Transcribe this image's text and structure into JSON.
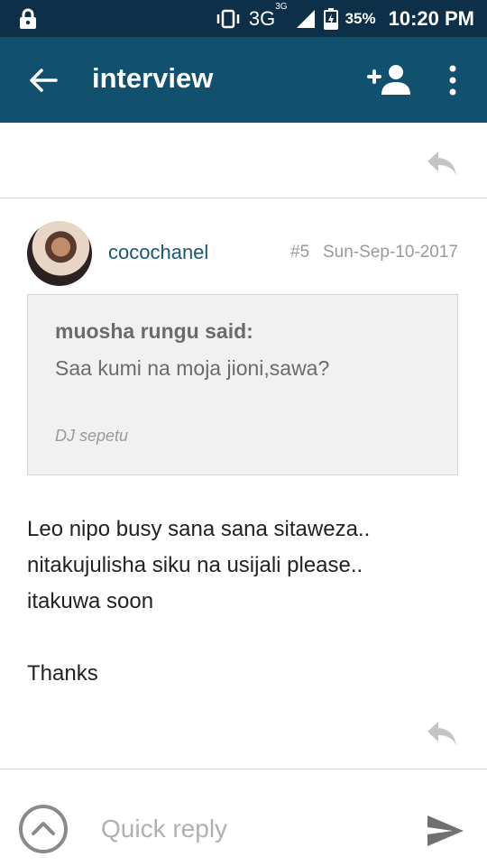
{
  "status_bar": {
    "lock_icon": "lock-icon",
    "vibrate_icon": "vibrate-icon",
    "network_label": "3G",
    "network_sup": "3G",
    "battery_percent": "35%",
    "time": "10:20 PM"
  },
  "app_bar": {
    "title": "interview",
    "back_icon": "arrow-back-icon",
    "add_user_icon": "person-add-icon",
    "more_icon": "more-vert-icon",
    "background": "#11506f"
  },
  "post": {
    "username": "cocochanel",
    "number": "#5",
    "date": "Sun-Sep-10-2017",
    "quote": {
      "author_line": "muosha rungu said:",
      "text": "Saa kumi na moja jioni,sawa?",
      "signature": "DJ sepetu"
    },
    "body": [
      "Leo nipo busy sana sana sitaweza..",
      "nitakujulisha siku na usijali please..",
      "itakuwa soon",
      "Thanks"
    ]
  },
  "quick_reply": {
    "placeholder": "Quick reply",
    "value": ""
  }
}
